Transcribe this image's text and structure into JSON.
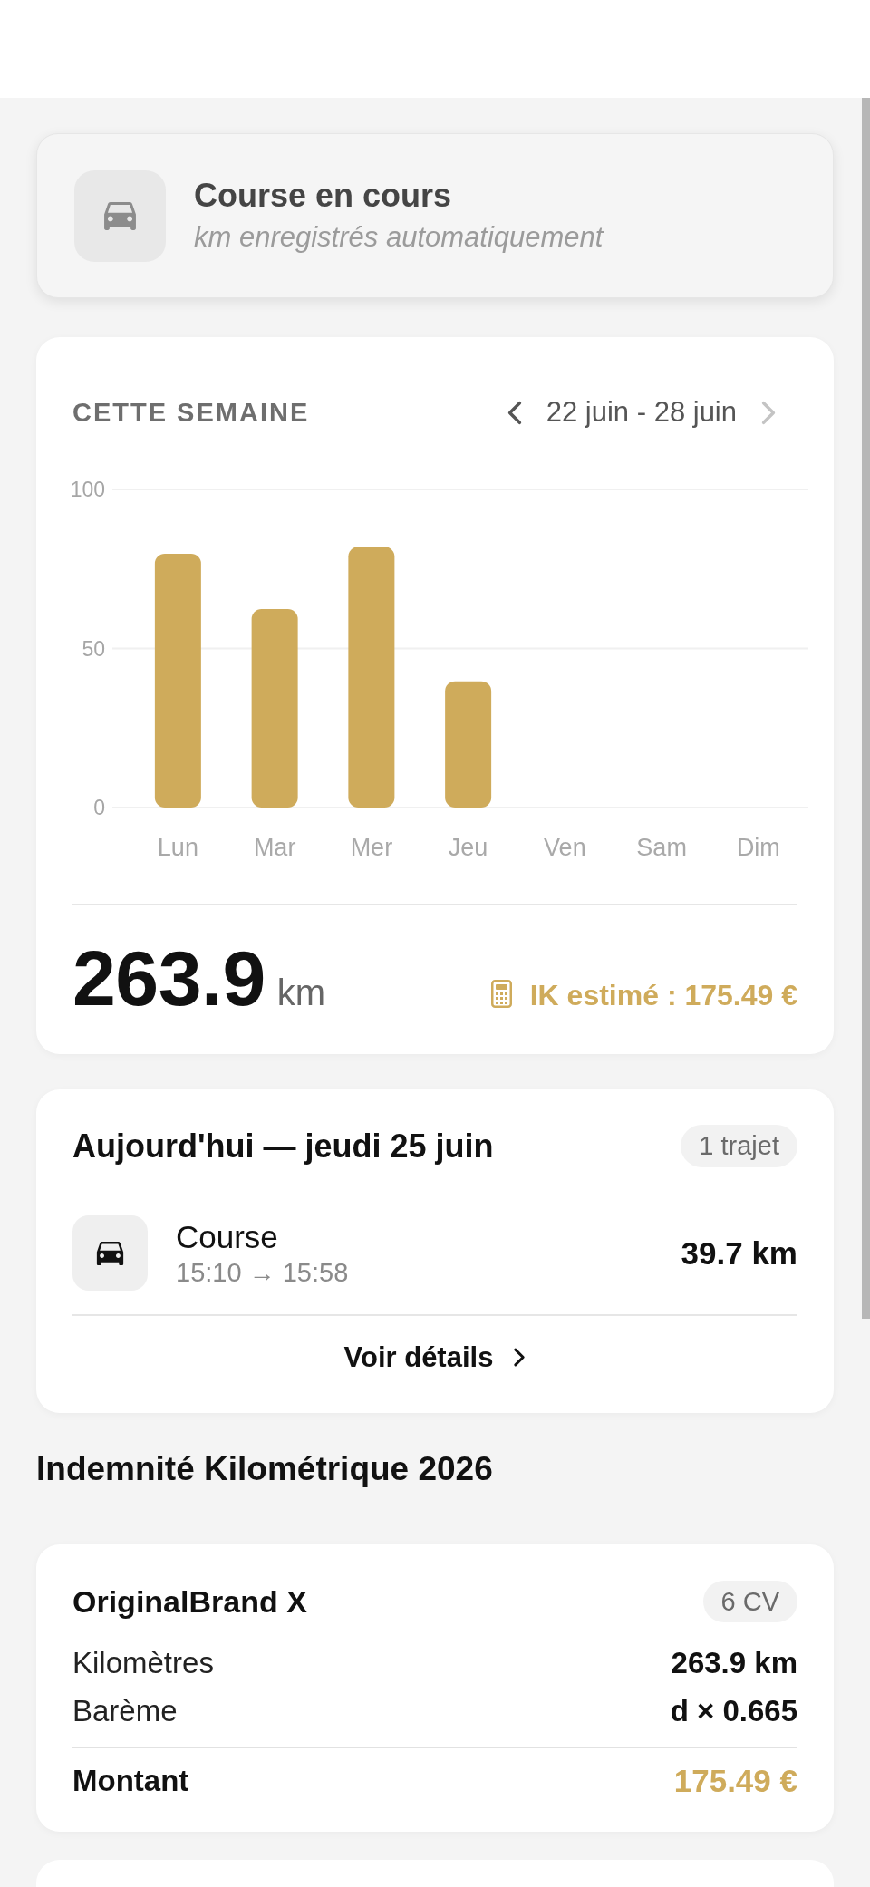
{
  "recording_card": {
    "title": "Course en cours",
    "subtitle": "km enregistrés automatiquement"
  },
  "week": {
    "title": "CETTE SEMAINE",
    "range": "22 juin - 28 juin",
    "nav": {
      "previous_disabled": false,
      "next_disabled": true
    },
    "chart_data": {
      "type": "bar",
      "categories": [
        "Lun",
        "Mar",
        "Mer",
        "Jeu",
        "Ven",
        "Sam",
        "Dim"
      ],
      "values": [
        79.8,
        62.4,
        82.0,
        39.7,
        0,
        0,
        0
      ],
      "ylim": [
        0,
        100
      ],
      "yticks": [
        0,
        50,
        100
      ]
    },
    "total": "263.9",
    "unit": "km",
    "estimate": "IK estimé : 175.49 €"
  },
  "today": {
    "title": "Aujourd'hui — jeudi 25 juin",
    "badge": "1 trajet",
    "trips": [
      {
        "name": "Course",
        "times": "15:10 → 15:58",
        "distance": "39.7 km"
      }
    ],
    "details_link": "Voir détails"
  },
  "ik": {
    "heading": "Indemnité Kilométrique 2026",
    "vehicle": {
      "name": "OriginalBrand X",
      "power": "6 CV",
      "rows": [
        {
          "kind": "plain",
          "label": "Kilomètres",
          "value": "263.9 km"
        },
        {
          "kind": "plain",
          "label": "Barème",
          "value": "d × 0.665"
        },
        {
          "kind": "total",
          "label": "Montant",
          "value": "175.49 €"
        }
      ]
    }
  }
}
